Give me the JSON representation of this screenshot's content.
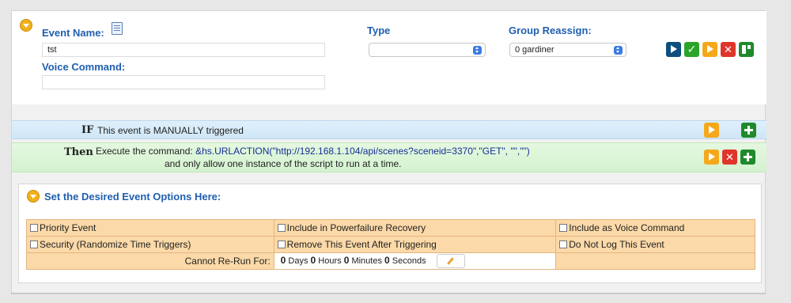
{
  "event": {
    "event_name_label": "Event Name:",
    "event_name_value": "tst",
    "voice_command_label": "Voice Command:",
    "voice_command_value": "",
    "type_label": "Type",
    "type_value": "",
    "group_label": "Group Reassign:",
    "group_value": "0 gardiner",
    "icons": [
      "notes-icon",
      "run-icon",
      "save-check-icon",
      "play-icon",
      "delete-icon",
      "split-icon"
    ]
  },
  "trigger": {
    "if_keyword": "IF",
    "if_text": "This event is MANUALLY triggered",
    "then_keyword": "Then",
    "then_prefix": "Execute the command:",
    "then_command": "&hs.URLACTION(\"http://192.168.1.104/api/scenes?sceneid=3370\",\"GET\", \"\",\"\")",
    "then_suffix": "and only allow one instance of the script to run at a time."
  },
  "options": {
    "title": "Set the Desired Event Options Here:",
    "row1": [
      "Priority Event",
      "Include in Powerfailure Recovery",
      "Include as Voice Command"
    ],
    "row2": [
      "Security (Randomize Time Triggers)",
      "Remove This Event After Triggering",
      "Do Not Log This Event"
    ],
    "rerun_label": "Cannot Re-Run For:",
    "rerun": {
      "days": "0",
      "days_label": "Days",
      "hours": "0",
      "hours_label": "Hours",
      "minutes": "0",
      "minutes_label": "Minutes",
      "seconds": "0",
      "seconds_label": "Seconds"
    }
  },
  "colors": {
    "label_blue": "#1f5fb0",
    "if_row": "#cfe6f6",
    "then_row": "#d4f2cf",
    "options_cell": "#fcd9a8",
    "accent_orange": "#f5a81a"
  }
}
